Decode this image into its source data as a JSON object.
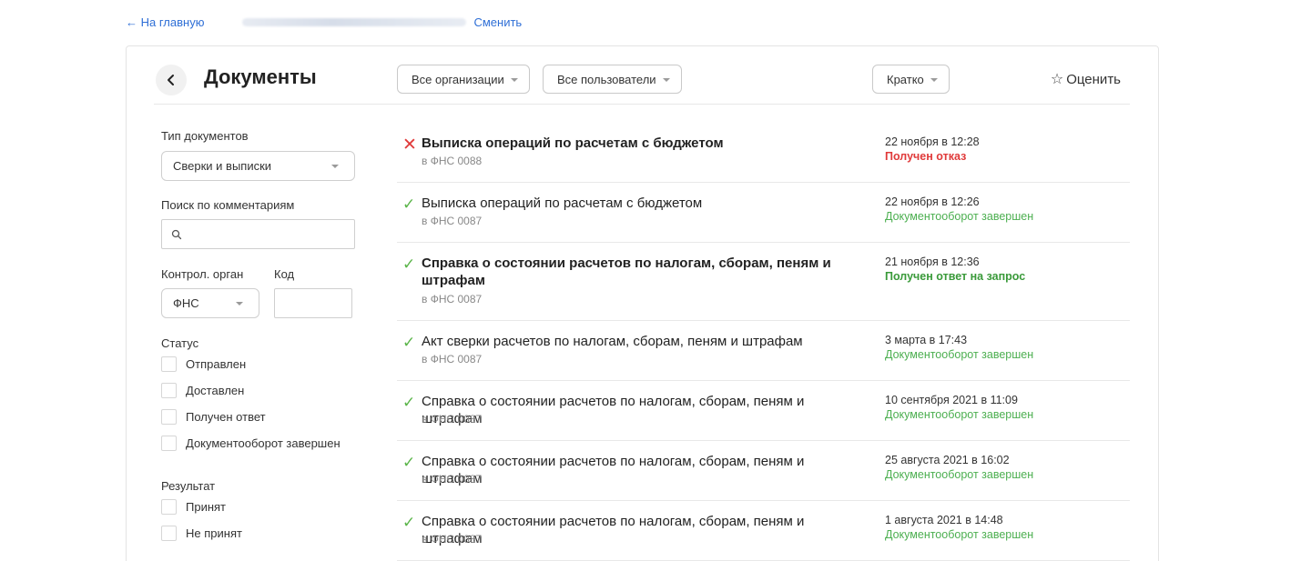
{
  "topbar": {
    "back_link": "← На главную",
    "change_link": "Сменить"
  },
  "header": {
    "title": "Документы",
    "org_filter": "Все организации",
    "user_filter": "Все пользователи",
    "view_mode": "Кратко",
    "rate_label": "Оценить"
  },
  "sidebar": {
    "doc_type_label": "Тип документов",
    "doc_type_value": "Сверки и выписки",
    "search_label": "Поиск по комментариям",
    "search_placeholder": "",
    "authority_label": "Контрол. орган",
    "authority_value": "ФНС",
    "code_label": "Код",
    "code_value": "",
    "status_label": "Статус",
    "status_options": [
      "Отправлен",
      "Доставлен",
      "Получен ответ",
      "Документооборот завершен"
    ],
    "result_label": "Результат",
    "result_options": [
      "Принят",
      "Не принят"
    ]
  },
  "documents": [
    {
      "title": "Выписка операций по расчетам с бюджетом",
      "recipient": "в ФНС 0088",
      "date": "22 ноября в 12:28",
      "status": "Получен отказ",
      "result": "fail",
      "status_style": "red",
      "bold": true
    },
    {
      "title": "Выписка операций по расчетам с бюджетом",
      "recipient": "в ФНС 0087",
      "date": "22 ноября в 12:26",
      "status": "Документооборот завершен",
      "result": "ok",
      "status_style": "green",
      "bold": false
    },
    {
      "title": "Справка о состоянии расчетов по налогам, сборам, пеням и штрафам",
      "recipient": "в ФНС 0087",
      "date": "21 ноября в 12:36",
      "status": "Получен ответ на запрос",
      "result": "ok",
      "status_style": "boldgreen",
      "bold": true
    },
    {
      "title": "Акт сверки расчетов по налогам, сборам, пеням и штрафам",
      "recipient": "в ФНС 0087",
      "date": "3 марта в 17:43",
      "status": "Документооборот завершен",
      "result": "ok",
      "status_style": "green",
      "bold": false
    },
    {
      "title": "Справка о состоянии расчетов по налогам, сборам, пеням и штрафам",
      "recipient": "в ФНС 0087",
      "date": "10 сентября 2021 в 11:09",
      "status": "Документооборот завершен",
      "result": "ok",
      "status_style": "green",
      "bold": false
    },
    {
      "title": "Справка о состоянии расчетов по налогам, сборам, пеням и штрафам",
      "recipient": "в ФНС 0087",
      "date": "25 августа 2021 в 16:02",
      "status": "Документооборот завершен",
      "result": "ok",
      "status_style": "green",
      "bold": false
    },
    {
      "title": "Справка о состоянии расчетов по налогам, сборам, пеням и штрафам",
      "recipient": "в ФНС 0087",
      "date": "1 августа 2021 в 14:48",
      "status": "Документооборот завершен",
      "result": "ok",
      "status_style": "green",
      "bold": false
    }
  ],
  "icons": {
    "ok": "✓",
    "fail": "✕",
    "star": "☆",
    "search": "search-icon",
    "back": "chevron-left-icon"
  },
  "colors": {
    "link": "#2f6fd6",
    "success": "#4caf50",
    "error": "#e03a3a"
  }
}
